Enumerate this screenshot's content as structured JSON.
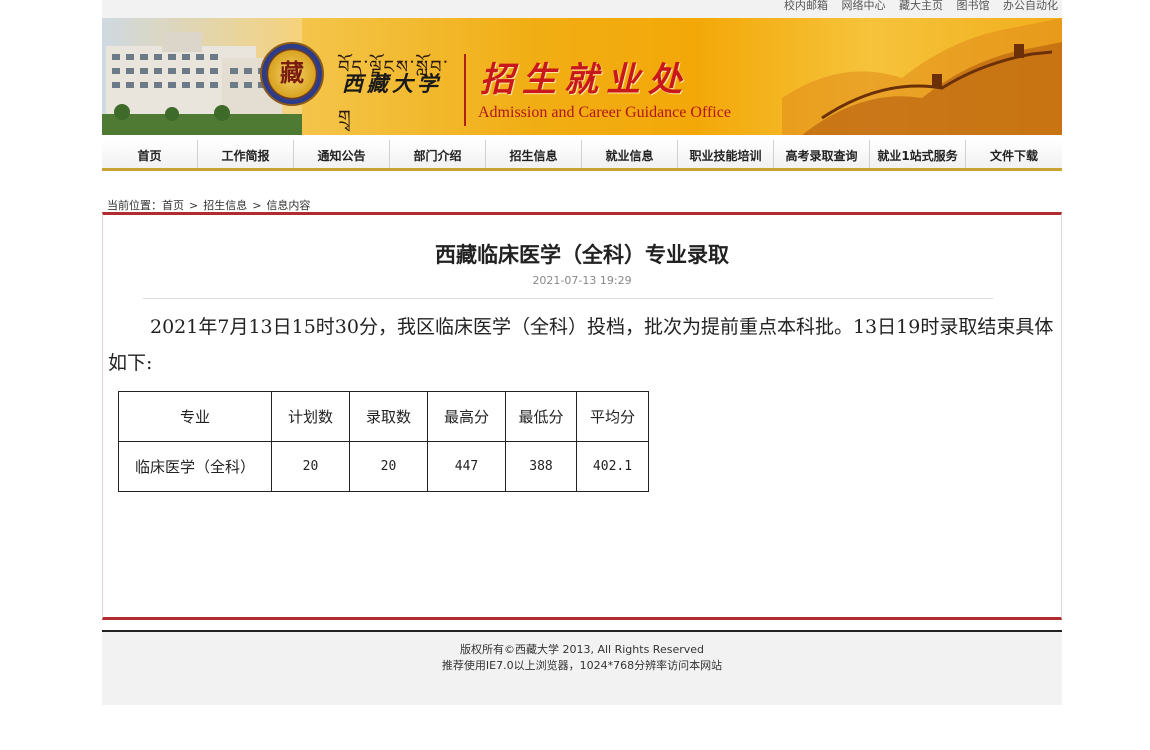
{
  "top_links": [
    "校内邮箱",
    "网络中心",
    "藏大主页",
    "图书馆",
    "办公自动化"
  ],
  "banner": {
    "seal_char": "藏",
    "tibetan_text": "བོད་ལྗོངས་སློབ་གྲྭ",
    "university_name": "西藏大学",
    "office_cn": "招生就业处",
    "office_en": "Admission and Career Guidance Office"
  },
  "nav": [
    "首页",
    "工作简报",
    "通知公告",
    "部门介绍",
    "招生信息",
    "就业信息",
    "职业技能培训",
    "高考录取查询",
    "就业1站式服务",
    "文件下载"
  ],
  "breadcrumb": {
    "prefix": "当前位置：",
    "items": [
      "首页",
      "招生信息",
      "信息内容"
    ],
    "separator": ">"
  },
  "article": {
    "title": "西藏临床医学（全科）专业录取",
    "date": "2021-07-13 19:29",
    "paragraph": "2021年7月13日15时30分，我区临床医学（全科）投档，批次为提前重点本科批。13日19时录取结束具体如下:",
    "table": {
      "headers": [
        "专业",
        "计划数",
        "录取数",
        "最高分",
        "最低分",
        "平均分"
      ],
      "rows": [
        [
          "临床医学（全科）",
          "20",
          "20",
          "447",
          "388",
          "402.1"
        ]
      ]
    }
  },
  "footer": {
    "line1": "版权所有©西藏大学 2013, All Rights Reserved",
    "line2": "推荐使用IE7.0以上浏览器，1024*768分辨率访问本网站"
  }
}
